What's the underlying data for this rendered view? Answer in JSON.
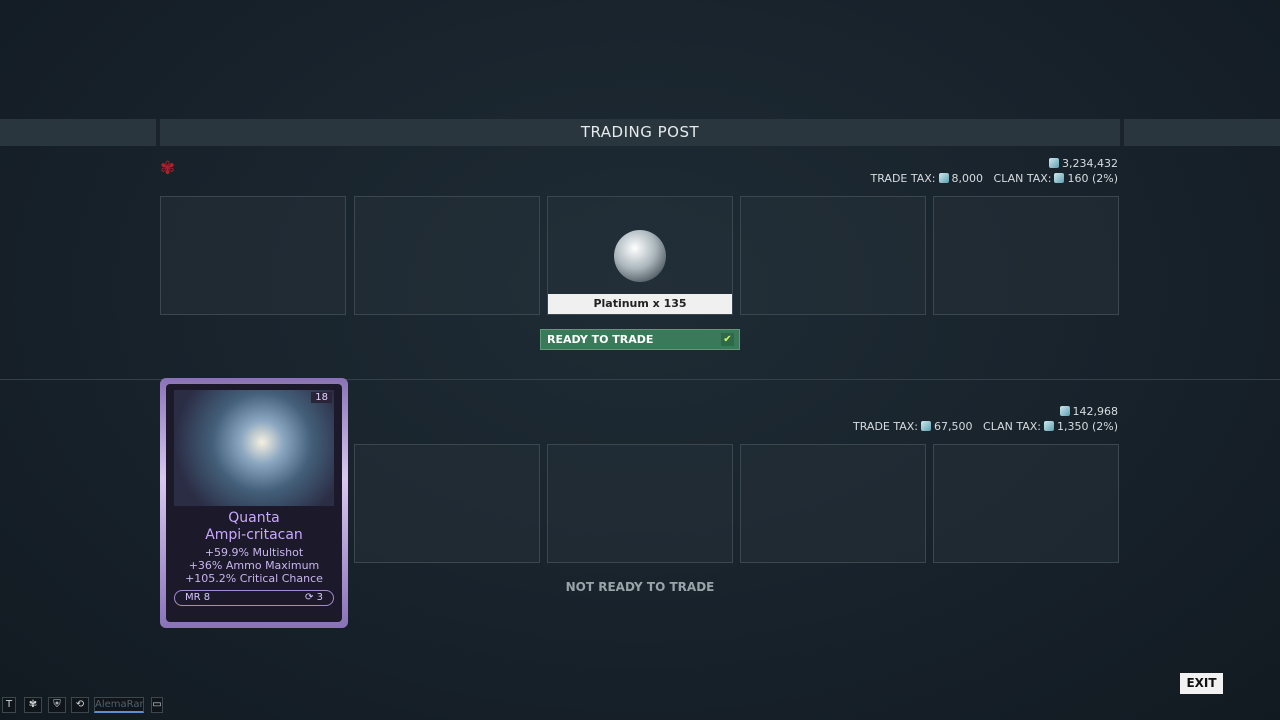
{
  "header": {
    "title": "TRADING POST"
  },
  "partner": {
    "balance": "3,234,432",
    "trade_tax_label": "TRADE TAX:",
    "trade_tax": "8,000",
    "clan_tax_label": "CLAN TAX:",
    "clan_tax": "160 (2%)",
    "offer": {
      "label": "Platinum x 135",
      "icon": "platinum-icon"
    },
    "status": "READY TO TRADE"
  },
  "self": {
    "balance": "142,968",
    "trade_tax_label": "TRADE TAX:",
    "trade_tax": "67,500",
    "clan_tax_label": "CLAN TAX:",
    "clan_tax": "1,350 (2%)",
    "status": "NOT READY TO TRADE",
    "mod": {
      "name1": "Quanta",
      "name2": "Ampi-critacan",
      "stats": [
        "+59.9% Multishot",
        "+36% Ammo Maximum",
        "+105.2% Critical Chance"
      ],
      "mr": "MR 8",
      "rerolls": "3",
      "rank": "18"
    }
  },
  "footer": {
    "exit": "EXIT",
    "chat_name": "AlemaRar",
    "t_button": "T"
  },
  "colors": {
    "ready": "#3a7a5a",
    "mod_text": "#c8a8ff",
    "clan": "#b0202a"
  }
}
